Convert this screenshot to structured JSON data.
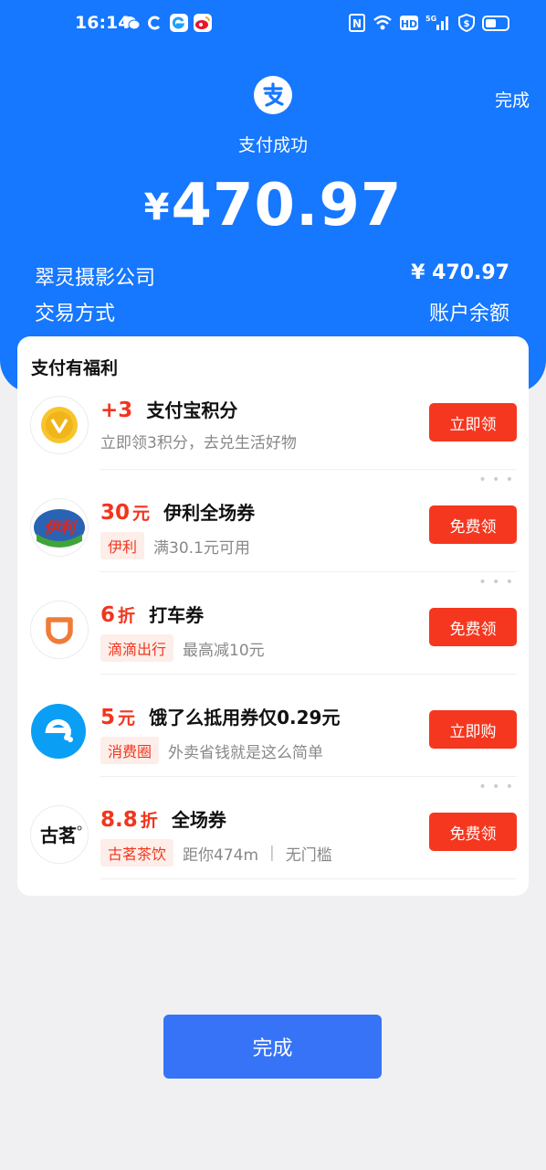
{
  "status_bar": {
    "time": "16:14",
    "network": "5G",
    "hd": "HD",
    "nfc": "N"
  },
  "header": {
    "done_label": "完成",
    "status": "支付成功",
    "currency": "¥",
    "amount": "470.97",
    "merchant": "翠灵摄影公司",
    "merchant_amount": "¥ 470.97",
    "method_label": "交易方式",
    "method_value": "账户余额"
  },
  "benefits": {
    "title": "支付有福利",
    "items": [
      {
        "value": "+3",
        "unit": "",
        "name": "支付宝积分",
        "tag": "",
        "desc": "立即领3积分，去兑生活好物",
        "desc2": "",
        "button": "立即领",
        "logo": "coin-icon"
      },
      {
        "value": "30",
        "unit": "元",
        "name": "伊利全场券",
        "tag": "伊利",
        "desc": "满30.1元可用",
        "desc2": "",
        "button": "免费领",
        "logo": "yili-logo",
        "logo_text": "伊利"
      },
      {
        "value": "6",
        "unit": "折",
        "name": "打车券",
        "tag": "滴滴出行",
        "desc": "最高减10元",
        "desc2": "",
        "button": "免费领",
        "logo": "didi-logo"
      },
      {
        "value": "5",
        "unit": "元",
        "name": "饿了么抵用券仅0.29元",
        "tag": "消费圈",
        "desc": "外卖省钱就是这么简单",
        "desc2": "",
        "button": "立即购",
        "logo": "eleme-logo"
      },
      {
        "value": "8.8",
        "unit": "折",
        "name": "全场券",
        "tag": "古茗茶饮",
        "desc": "距你474m",
        "desc2": "无门槛",
        "button": "免费领",
        "logo": "guming-logo",
        "logo_text": "古茗"
      }
    ]
  },
  "footer": {
    "done_label": "完成"
  },
  "colors": {
    "brand_blue": "#1677ff",
    "button_red": "#f5371f",
    "button_blue": "#3673f6"
  }
}
